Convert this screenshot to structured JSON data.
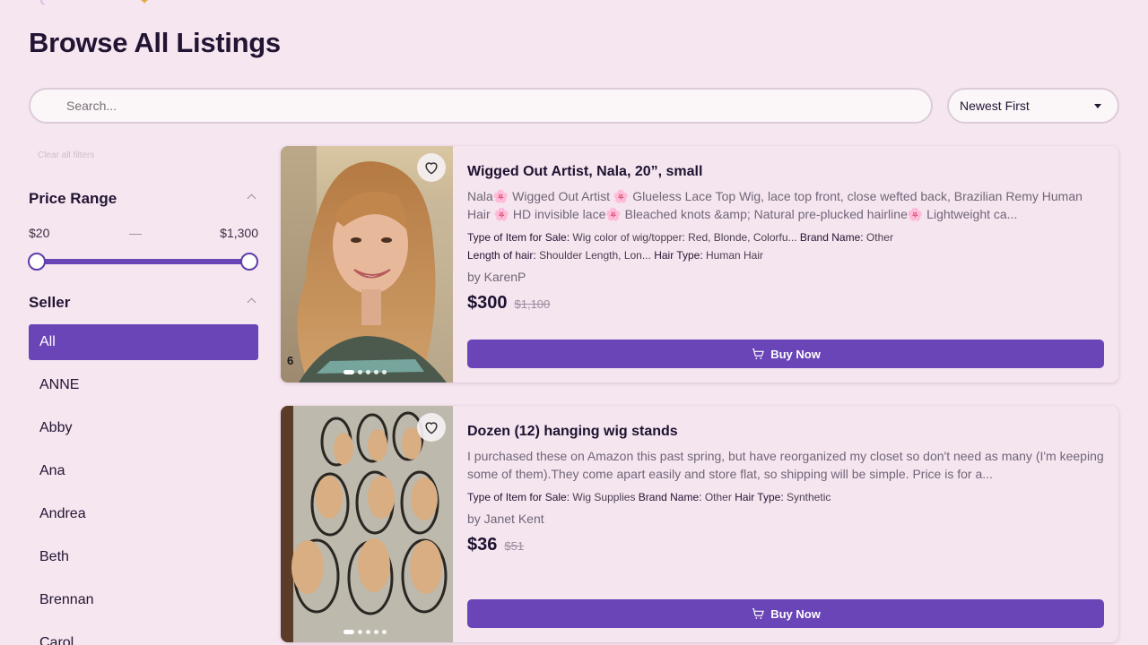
{
  "page": {
    "title": "Browse All Listings"
  },
  "search": {
    "placeholder": "Search..."
  },
  "sort": {
    "selected": "Newest First"
  },
  "filters": {
    "clear_label": "Clear all filters",
    "price": {
      "label": "Price Range",
      "min": "$20",
      "dash": "—",
      "max": "$1,300"
    },
    "seller": {
      "label": "Seller",
      "items": [
        "All",
        "ANNE",
        "Abby",
        "Ana",
        "Andrea",
        "Beth",
        "Brennan",
        "Carol"
      ],
      "selected": "All"
    }
  },
  "listings": [
    {
      "title": "Wigged Out Artist, Nala, 20”, small",
      "description": "Nala🌸 Wigged Out Artist 🌸 Glueless Lace Top Wig, lace top front, close wefted back, Brazilian Remy Human Hair 🌸 HD invisible lace🌸 Bleached knots &amp; Natural pre-plucked hairline🌸 Lightweight ca...",
      "attrs_line1": [
        {
          "k": "Type of Item for Sale:",
          "v": "Wig color of wig/topper: Red, Blonde, Colorfu..."
        },
        {
          "k": "Brand Name:",
          "v": "Other"
        }
      ],
      "attrs_line2": [
        {
          "k": "Length of hair:",
          "v": "Shoulder Length, Lon..."
        },
        {
          "k": "Hair Type:",
          "v": "Human Hair"
        }
      ],
      "seller": "by KarenP",
      "price": "$300",
      "original_price": "$1,100",
      "image_count": "6",
      "buy_label": "Buy Now"
    },
    {
      "title": "Dozen (12) hanging wig stands",
      "description": "I purchased these on Amazon this past spring, but have reorganized my closet so don't need as many (I'm keeping some of them).They come apart easily and store flat, so shipping will be simple. Price is for a...",
      "attrs_line1": [
        {
          "k": "Type of Item for Sale:",
          "v": "Wig Supplies"
        },
        {
          "k": "Brand Name:",
          "v": "Other"
        },
        {
          "k": "Hair Type:",
          "v": "Synthetic"
        }
      ],
      "seller": "by Janet Kent",
      "price": "$36",
      "original_price": "$51",
      "buy_label": "Buy Now"
    }
  ],
  "colors": {
    "accent": "#6a45b8",
    "background": "#f6e6f0"
  },
  "icons": [
    "heart-icon",
    "cart-icon",
    "chevron-up-icon",
    "caret-down-icon"
  ]
}
